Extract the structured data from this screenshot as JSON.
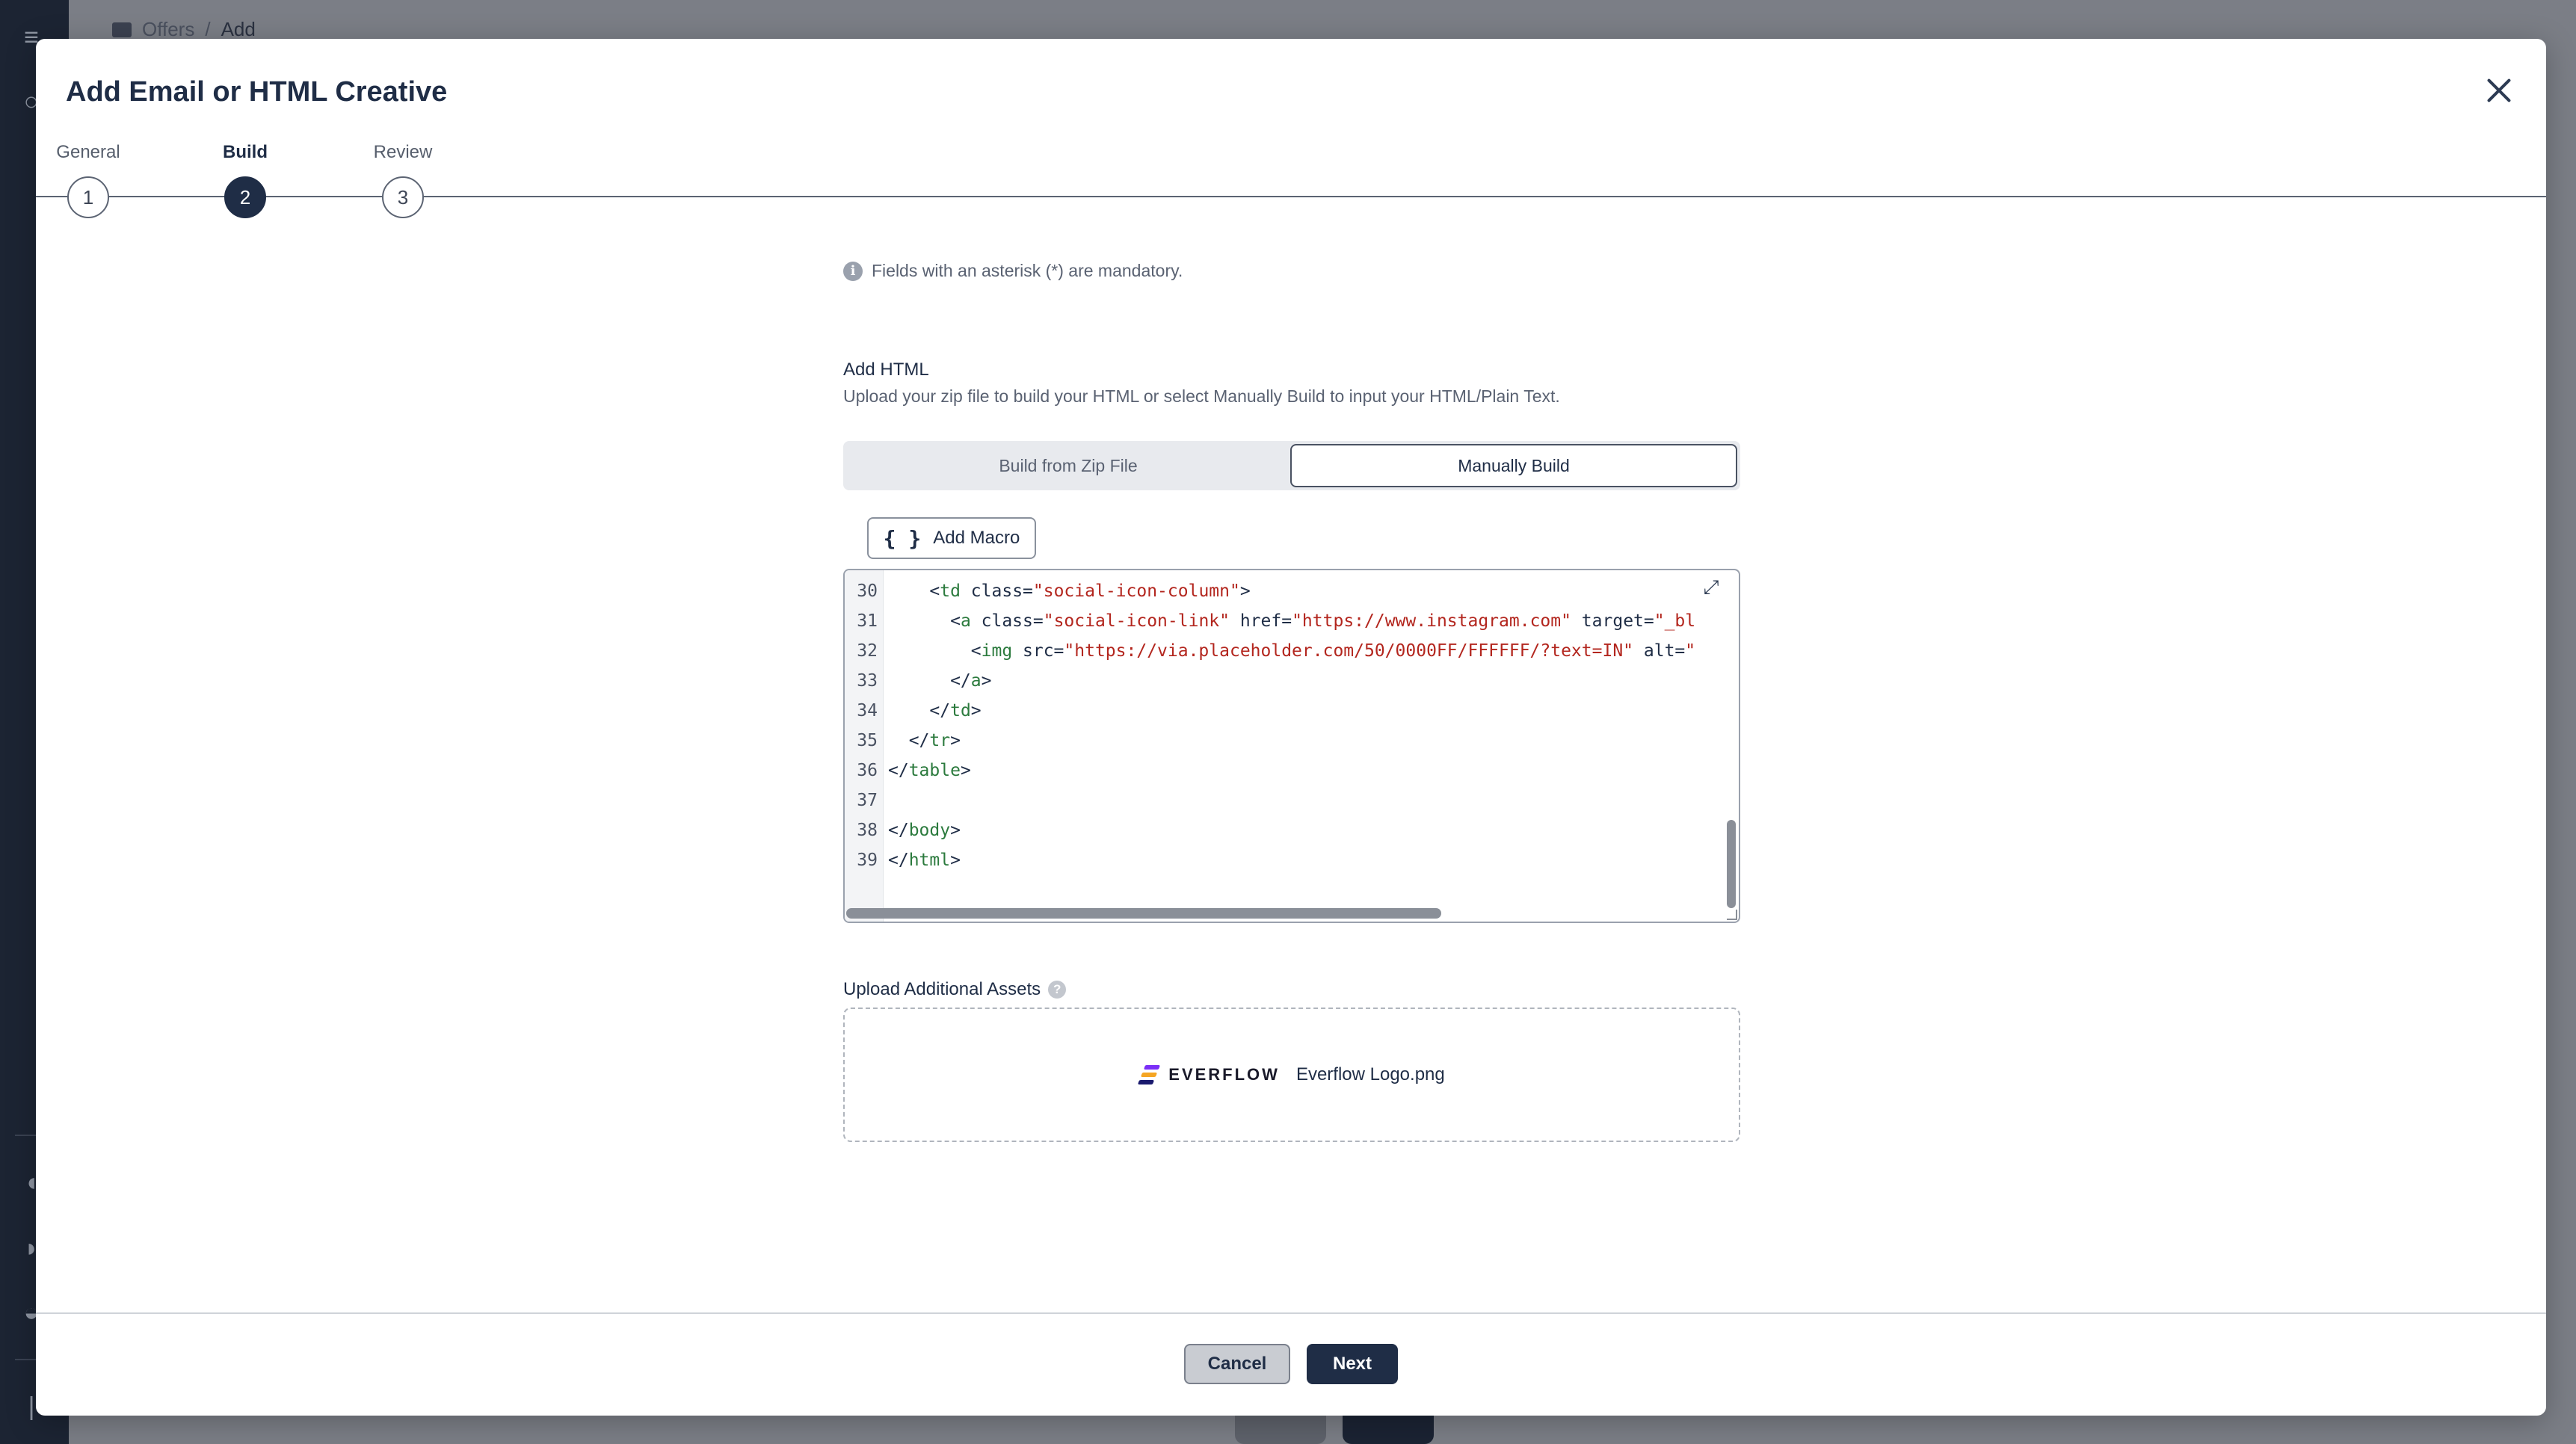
{
  "background": {
    "breadcrumb": {
      "root": "Offers",
      "separator": "/",
      "current": "Add"
    }
  },
  "modal": {
    "title": "Add Email or HTML Creative",
    "close_icon": "close-icon"
  },
  "steps": [
    {
      "label": "General",
      "number": "1",
      "state": "done"
    },
    {
      "label": "Build",
      "number": "2",
      "state": "active"
    },
    {
      "label": "Review",
      "number": "3",
      "state": "pending"
    }
  ],
  "notice": {
    "icon": "info-icon",
    "text": "Fields with an asterisk (*) are mandatory."
  },
  "add_html": {
    "title": "Add HTML",
    "description": "Upload your zip file to build your HTML or select Manually Build to input your HTML/Plain Text."
  },
  "build_mode": {
    "options": [
      "Build from Zip File",
      "Manually Build"
    ],
    "selected": "Manually Build"
  },
  "macro_button": {
    "icon": "curly-braces-icon",
    "label": "Add Macro"
  },
  "editor": {
    "expand_icon": "expand-icon",
    "lines": [
      {
        "n": "30",
        "code": "    <td class=\"social-icon-column\">"
      },
      {
        "n": "31",
        "code": "      <a class=\"social-icon-link\" href=\"https://www.instagram.com\" target=\"_bl"
      },
      {
        "n": "32",
        "code": "        <img src=\"https://via.placeholder.com/50/0000FF/FFFFFF/?text=IN\" alt=\""
      },
      {
        "n": "33",
        "code": "      </a>"
      },
      {
        "n": "34",
        "code": "    </td>"
      },
      {
        "n": "35",
        "code": "  </tr>"
      },
      {
        "n": "36",
        "code": "</table>"
      },
      {
        "n": "37",
        "code": ""
      },
      {
        "n": "38",
        "code": "</body>"
      },
      {
        "n": "39",
        "code": "</html>"
      }
    ]
  },
  "assets": {
    "label": "Upload Additional Assets",
    "help_icon": "help-icon",
    "logo_text": "EVERFLOW",
    "filename": "Everflow Logo.png"
  },
  "footer": {
    "cancel_label": "Cancel",
    "next_label": "Next"
  },
  "colors": {
    "primary": "#1f2d46",
    "sidebar": "#1c2433",
    "overlay": "#6d7079"
  }
}
